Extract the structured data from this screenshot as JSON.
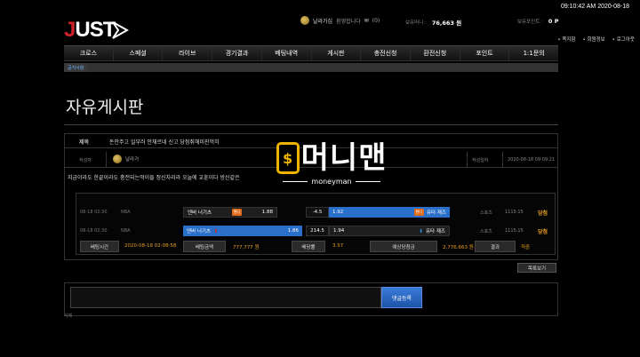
{
  "header": {
    "logo_j": "J",
    "logo_rest": "UST",
    "clock": "09:10:42 AM 2020-08-18",
    "user_name": "날라가십",
    "welcome": "환영합니다",
    "message_count": "(0)",
    "money_label": "보유머니 :",
    "money_value": "76,663 원",
    "points_label": "보유포인트 :",
    "points_value": "0 P",
    "links": [
      "쪽지함",
      "회원정보",
      "로그아웃"
    ]
  },
  "nav": {
    "items": [
      "크로스",
      "스페셜",
      "라이브",
      "경기결과",
      "베팅내역",
      "게시판",
      "충전신청",
      "환전신청",
      "포인트",
      "1:1문의"
    ]
  },
  "subbar": {
    "tag": "공지사항"
  },
  "page": {
    "title": "자유게시판"
  },
  "post": {
    "title_label": "제목",
    "title_value": "돈안주고 일부러 안채르네 신고 당첨취해미친먹히",
    "author_label": "작성자",
    "author_name": "날라가",
    "date_label": "작성일자",
    "date_value": "2020-08-18 09:09:21",
    "body": "지금이라도 한끝이라도 충전되는먹이들 정신차리라 오늘에 교훈이다 방신같은"
  },
  "bets": {
    "rows": [
      {
        "time": "08-18 02:30",
        "league": "NBA",
        "home": "덴버 너기츠",
        "home_badge": "핸디",
        "home_odds": "1.88",
        "line": "-4.5",
        "away_odds": "1.92",
        "away_badge": "핸디",
        "away": "유타 재즈",
        "sport": "스포츠",
        "status_time": "1115:15",
        "result": "당첨"
      },
      {
        "time": "08-18 02:30",
        "league": "NBA",
        "home": "덴버 너기츠",
        "home_arrow": "⬆",
        "home_odds": "1.86",
        "line": "214.5",
        "away_odds": "1.94",
        "away_arrow": "⬇",
        "away": "유타 재즈",
        "sport": "스포츠",
        "status_time": "1115:15",
        "result": "당첨"
      }
    ],
    "summary": {
      "bet_time_label": "베팅시간",
      "bet_time_value": "2020-08-18 02:08:58",
      "bet_amount_label": "베팅금액",
      "bet_amount_value": "777,777 원",
      "odds_label": "배당률",
      "odds_value": "3.57",
      "expected_label": "예상당첨금",
      "expected_value": "2,776,663 원",
      "result_label": "결과",
      "result_value": "적중"
    }
  },
  "actions": {
    "list_button": "목록보기",
    "comment_button": "댓글등록",
    "delete_link": "삭제"
  },
  "watermark": {
    "symbol": "$",
    "main": "머니맨",
    "sub": "moneyman"
  },
  "colors": {
    "accent_orange": "#e8a020",
    "accent_blue": "#2a6fc9",
    "logo_red": "#d0202a",
    "watermark_yellow": "#f0b400"
  }
}
